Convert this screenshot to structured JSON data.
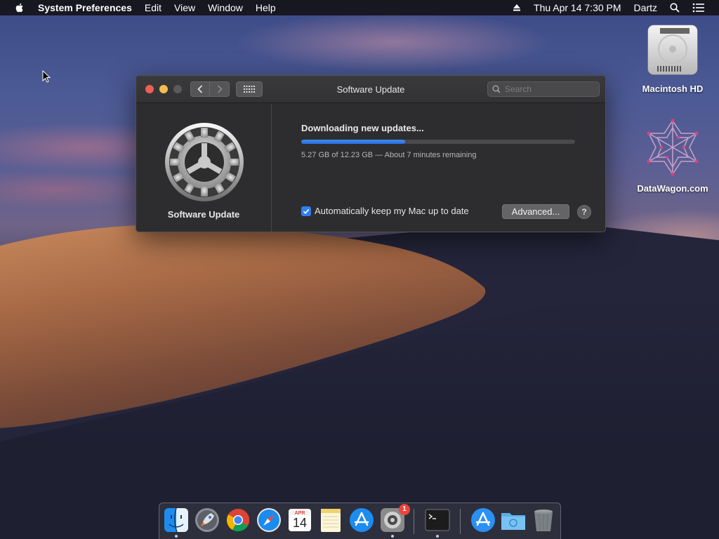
{
  "menubar": {
    "app_name": "System Preferences",
    "menus": [
      "Edit",
      "View",
      "Window",
      "Help"
    ],
    "datetime": "Thu Apr 14  7:30 PM",
    "user": "Dartz"
  },
  "desktop": {
    "icons": [
      {
        "label": "Macintosh HD",
        "icon": "hard-drive-icon"
      },
      {
        "label": "DataWagon.com",
        "icon": "network-graphic-icon"
      }
    ]
  },
  "window": {
    "title": "Software Update",
    "search_placeholder": "Search",
    "panel_label": "Software Update",
    "status_title": "Downloading new updates...",
    "progress_fraction": 0.38,
    "progress_detail": "5.27 GB of 12.23 GB — About 7 minutes remaining",
    "auto_update_label": "Automatically keep my Mac up to date",
    "auto_update_checked": true,
    "advanced_label": "Advanced...",
    "help_label": "?"
  },
  "dock": {
    "calendar_month": "APR",
    "calendar_day": "14",
    "system_prefs_badge": "1",
    "apps": [
      "finder",
      "launchpad",
      "chrome",
      "safari",
      "calendar",
      "notes",
      "app-store",
      "system-preferences",
      "terminal",
      "app-store-downloads",
      "downloads-folder",
      "trash"
    ]
  },
  "colors": {
    "accent": "#2f7ff0",
    "close": "#ed5f57",
    "minimize": "#f4bd4f",
    "badge": "#f0433a"
  }
}
